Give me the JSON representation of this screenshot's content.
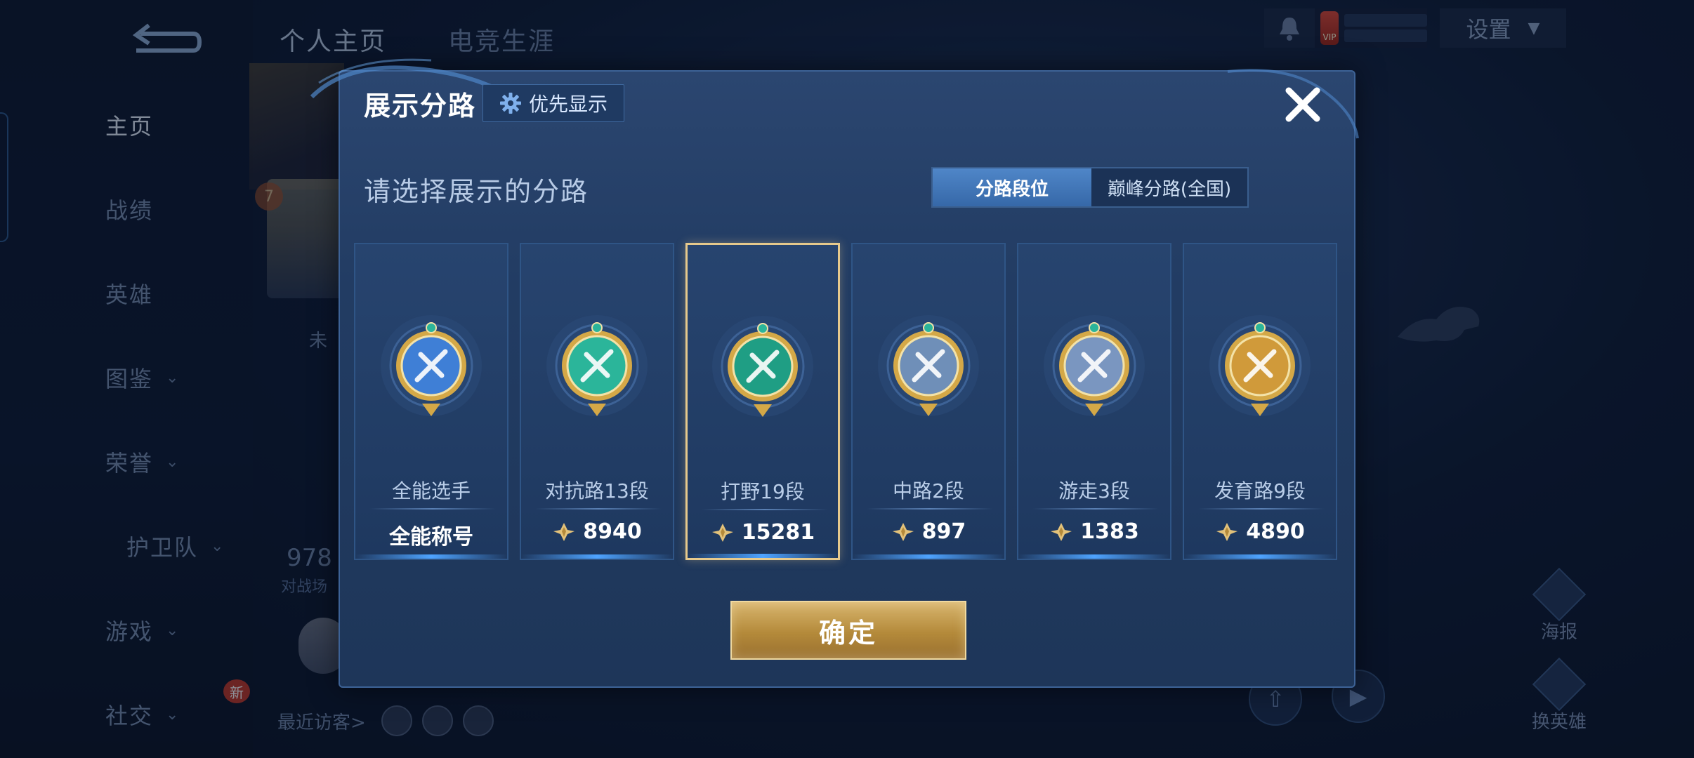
{
  "app": {
    "back_label": "",
    "top_tabs": [
      "个人主页",
      "电竞生涯"
    ],
    "settings_label": "设置",
    "vip_label": "VIP",
    "sidebar": [
      {
        "label": "主页",
        "active": true,
        "chevron": false
      },
      {
        "label": "战绩",
        "active": false,
        "chevron": false
      },
      {
        "label": "英雄",
        "active": false,
        "chevron": false
      },
      {
        "label": "图鉴",
        "active": false,
        "chevron": true
      },
      {
        "label": "荣誉",
        "active": false,
        "chevron": true
      },
      {
        "label": "护卫队",
        "active": false,
        "chevron": true
      },
      {
        "label": "游戏",
        "active": false,
        "chevron": true
      },
      {
        "label": "社交",
        "active": false,
        "chevron": true
      }
    ],
    "social_badge": "新",
    "level_badge": "7",
    "bg_tag": "未",
    "bg_stat_num": "978",
    "bg_stat_label": "对战场",
    "visitors_label": "最近访客>",
    "right_tools": {
      "poster": "海报",
      "change_hero": "换英雄"
    }
  },
  "modal": {
    "title": "展示分路",
    "priority_label": "优先显示",
    "subtitle": "请选择展示的分路",
    "toggle": {
      "active": "分路段位",
      "inactive": "巅峰分路(全国)"
    },
    "cards": [
      {
        "title": "全能选手",
        "value": "全能称号",
        "points": false,
        "selected": false,
        "emblem": "all-round-emblem-icon",
        "color": "#3f7fd6"
      },
      {
        "title": "对抗路13段",
        "value": "8940",
        "points": true,
        "selected": false,
        "emblem": "clash-lane-emblem-icon",
        "color": "#2bb59a"
      },
      {
        "title": "打野19段",
        "value": "15281",
        "points": true,
        "selected": true,
        "emblem": "jungle-emblem-icon",
        "color": "#1f9e84"
      },
      {
        "title": "中路2段",
        "value": "897",
        "points": true,
        "selected": false,
        "emblem": "mid-lane-emblem-icon",
        "color": "#6f8fb8"
      },
      {
        "title": "游走3段",
        "value": "1383",
        "points": true,
        "selected": false,
        "emblem": "roam-emblem-icon",
        "color": "#7a96c0"
      },
      {
        "title": "发育路9段",
        "value": "4890",
        "points": true,
        "selected": false,
        "emblem": "farm-lane-emblem-icon",
        "color": "#d09a3a"
      }
    ],
    "confirm_label": "确定"
  }
}
